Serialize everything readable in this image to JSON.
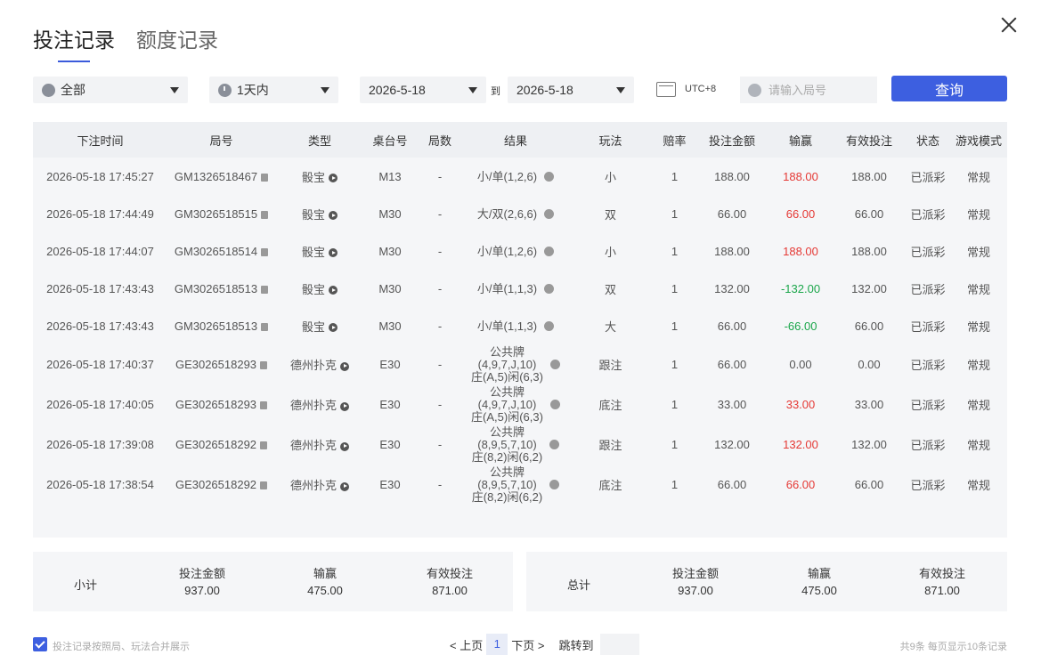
{
  "tabs": [
    "投注记录",
    "额度记录"
  ],
  "filters": {
    "category": "全部",
    "period": "1天内",
    "date_from": "2026-5-18",
    "to_label": "到",
    "date_to": "2026-5-18",
    "timezone": "UTC+8",
    "search_placeholder": "请输入局号",
    "query_button": "查询"
  },
  "table": {
    "headers": [
      "下注时间",
      "局号",
      "类型",
      "桌台号",
      "局数",
      "结果",
      "玩法",
      "赔率",
      "投注金额",
      "输赢",
      "有效投注",
      "状态",
      "游戏模式"
    ],
    "rows": [
      {
        "time": "2026-05-18 17:45:27",
        "id": "GM1326518467",
        "type": "骰宝",
        "table": "M13",
        "rounds": "-",
        "result": [
          "小/单(1,2,6)"
        ],
        "play": "小",
        "odds": "1",
        "bet": "188.00",
        "win": "188.00",
        "win_color": "red",
        "valid": "188.00",
        "status": "已派彩",
        "mode": "常规"
      },
      {
        "time": "2026-05-18 17:44:49",
        "id": "GM3026518515",
        "type": "骰宝",
        "table": "M30",
        "rounds": "-",
        "result": [
          "大/双(2,6,6)"
        ],
        "play": "双",
        "odds": "1",
        "bet": "66.00",
        "win": "66.00",
        "win_color": "red",
        "valid": "66.00",
        "status": "已派彩",
        "mode": "常规"
      },
      {
        "time": "2026-05-18 17:44:07",
        "id": "GM3026518514",
        "type": "骰宝",
        "table": "M30",
        "rounds": "-",
        "result": [
          "小/单(1,2,6)"
        ],
        "play": "小",
        "odds": "1",
        "bet": "188.00",
        "win": "188.00",
        "win_color": "red",
        "valid": "188.00",
        "status": "已派彩",
        "mode": "常规"
      },
      {
        "time": "2026-05-18 17:43:43",
        "id": "GM3026518513",
        "type": "骰宝",
        "table": "M30",
        "rounds": "-",
        "result": [
          "小/单(1,1,3)"
        ],
        "play": "双",
        "odds": "1",
        "bet": "132.00",
        "win": "-132.00",
        "win_color": "green",
        "valid": "132.00",
        "status": "已派彩",
        "mode": "常规"
      },
      {
        "time": "2026-05-18 17:43:43",
        "id": "GM3026518513",
        "type": "骰宝",
        "table": "M30",
        "rounds": "-",
        "result": [
          "小/单(1,1,3)"
        ],
        "play": "大",
        "odds": "1",
        "bet": "66.00",
        "win": "-66.00",
        "win_color": "green",
        "valid": "66.00",
        "status": "已派彩",
        "mode": "常规"
      },
      {
        "time": "2026-05-18 17:40:37",
        "id": "GE3026518293",
        "type": "德州扑克",
        "table": "E30",
        "rounds": "-",
        "result": [
          "公共牌",
          "(4,9,7,J,10)",
          "庄(A,5)闲(6,3)"
        ],
        "play": "跟注",
        "odds": "1",
        "bet": "66.00",
        "win": "0.00",
        "win_color": "normal",
        "valid": "0.00",
        "status": "已派彩",
        "mode": "常规"
      },
      {
        "time": "2026-05-18 17:40:05",
        "id": "GE3026518293",
        "type": "德州扑克",
        "table": "E30",
        "rounds": "-",
        "result": [
          "公共牌",
          "(4,9,7,J,10)",
          "庄(A,5)闲(6,3)"
        ],
        "play": "底注",
        "odds": "1",
        "bet": "33.00",
        "win": "33.00",
        "win_color": "red",
        "valid": "33.00",
        "status": "已派彩",
        "mode": "常规"
      },
      {
        "time": "2026-05-18 17:39:08",
        "id": "GE3026518292",
        "type": "德州扑克",
        "table": "E30",
        "rounds": "-",
        "result": [
          "公共牌",
          "(8,9,5,7,10)",
          "庄(8,2)闲(6,2)"
        ],
        "play": "跟注",
        "odds": "1",
        "bet": "132.00",
        "win": "132.00",
        "win_color": "red",
        "valid": "132.00",
        "status": "已派彩",
        "mode": "常规"
      },
      {
        "time": "2026-05-18 17:38:54",
        "id": "GE3026518292",
        "type": "德州扑克",
        "table": "E30",
        "rounds": "-",
        "result": [
          "公共牌",
          "(8,9,5,7,10)",
          "庄(8,2)闲(6,2)"
        ],
        "play": "底注",
        "odds": "1",
        "bet": "66.00",
        "win": "66.00",
        "win_color": "red",
        "valid": "66.00",
        "status": "已派彩",
        "mode": "常规"
      }
    ]
  },
  "subtotal": {
    "label": "小计",
    "bet_label": "投注金额",
    "bet": "937.00",
    "win_label": "输赢",
    "win": "475.00",
    "valid_label": "有效投注",
    "valid": "871.00"
  },
  "total": {
    "label": "总计",
    "bet_label": "投注金额",
    "bet": "937.00",
    "win_label": "输赢",
    "win": "475.00",
    "valid_label": "有效投注",
    "valid": "871.00"
  },
  "footer": {
    "merge_label": "投注记录按照局、玩法合并展示",
    "prev": "< 上页",
    "current_page": "1",
    "next": "下页 >",
    "jump_label": "跳转到",
    "summary": "共9条  每页显示10条记录"
  },
  "colors": {
    "accent": "#3d5fe0",
    "loss": "#1aa64a",
    "win": "#e53935"
  }
}
